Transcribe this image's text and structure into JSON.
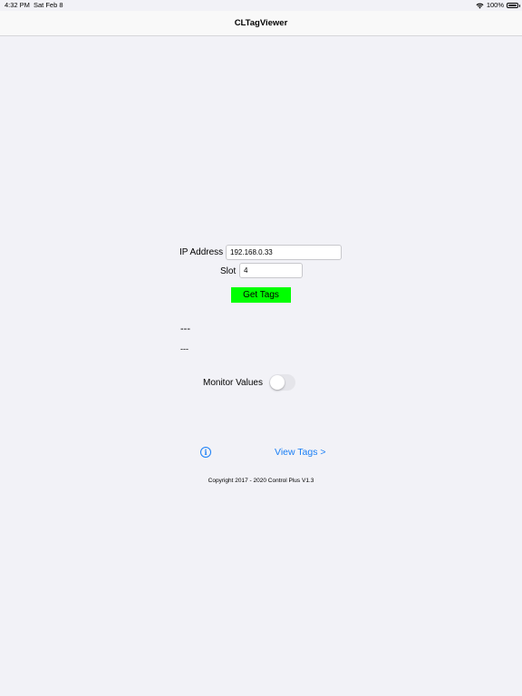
{
  "status_bar": {
    "time": "4:32 PM",
    "date": "Sat Feb 8",
    "battery": "100%"
  },
  "nav": {
    "title": "CLTagViewer"
  },
  "form": {
    "ip_label": "IP Address",
    "ip_value": "192.168.0.33",
    "slot_label": "Slot",
    "slot_value": "4",
    "get_tags_label": "Get Tags",
    "get_tags_color": "#00ff00"
  },
  "output": {
    "line1": "---",
    "line2": "---"
  },
  "monitor": {
    "label": "Monitor Values",
    "enabled": false
  },
  "footer": {
    "info_icon": "info-icon",
    "view_tags_label": "View Tags >",
    "copyright": "Copyright 2017 - 2020 Control Plus V1.3"
  },
  "colors": {
    "background": "#f2f2f7",
    "accent": "#1a7ff6"
  }
}
